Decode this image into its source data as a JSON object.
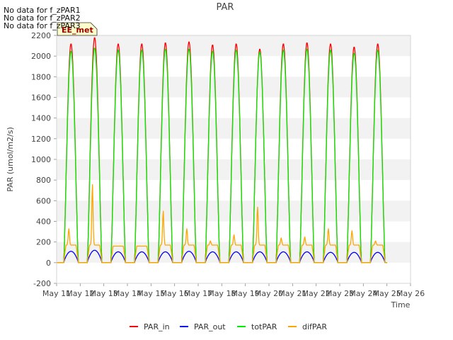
{
  "no_data_messages": [
    "No data for f_zPAR1",
    "No data for f_zPAR2",
    "No data for f_zPAR3"
  ],
  "badge": "EE_met",
  "colors": {
    "PAR_in": "#ff0000",
    "PAR_out": "#0000ff",
    "totPAR": "#00ee00",
    "difPAR": "#ffa500",
    "band": "#f2f2f2",
    "badge_bg": "#ffffcc",
    "badge_text": "#990000"
  },
  "chart_data": {
    "type": "line",
    "title": "PAR",
    "xlabel": "Time",
    "ylabel": "PAR (umol/m2/s)",
    "ylim": [
      -200,
      2200
    ],
    "yticks": [
      -200,
      0,
      200,
      400,
      600,
      800,
      1000,
      1200,
      1400,
      1600,
      1800,
      2000,
      2200
    ],
    "xlim": [
      11,
      26
    ],
    "xtick_labels": [
      "May 11",
      "May 12",
      "May 13",
      "May 14",
      "May 15",
      "May 16",
      "May 17",
      "May 18",
      "May 19",
      "May 20",
      "May 21",
      "May 22",
      "May 23",
      "May 24",
      "May 25",
      "May 26"
    ],
    "grid": "horizontal bands",
    "legend_position": "bottom",
    "series": [
      {
        "name": "PAR_in",
        "daily_peaks": [
          2120,
          2180,
          2120,
          2120,
          2130,
          2140,
          2110,
          2120,
          2070,
          2120,
          2130,
          2120,
          2090,
          2120
        ]
      },
      {
        "name": "PAR_out",
        "daily_peaks": [
          110,
          120,
          105,
          105,
          105,
          110,
          105,
          105,
          105,
          105,
          105,
          100,
          100,
          100
        ]
      },
      {
        "name": "totPAR",
        "daily_peaks": [
          2050,
          2080,
          2060,
          2060,
          2070,
          2070,
          2050,
          2060,
          2040,
          2060,
          2070,
          2060,
          2030,
          2060
        ]
      },
      {
        "name": "difPAR",
        "daily_peaks": [
          330,
          760,
          160,
          160,
          500,
          330,
          210,
          270,
          540,
          240,
          250,
          330,
          310,
          210
        ]
      }
    ],
    "day_start": 0.3,
    "day_end": 0.92
  }
}
